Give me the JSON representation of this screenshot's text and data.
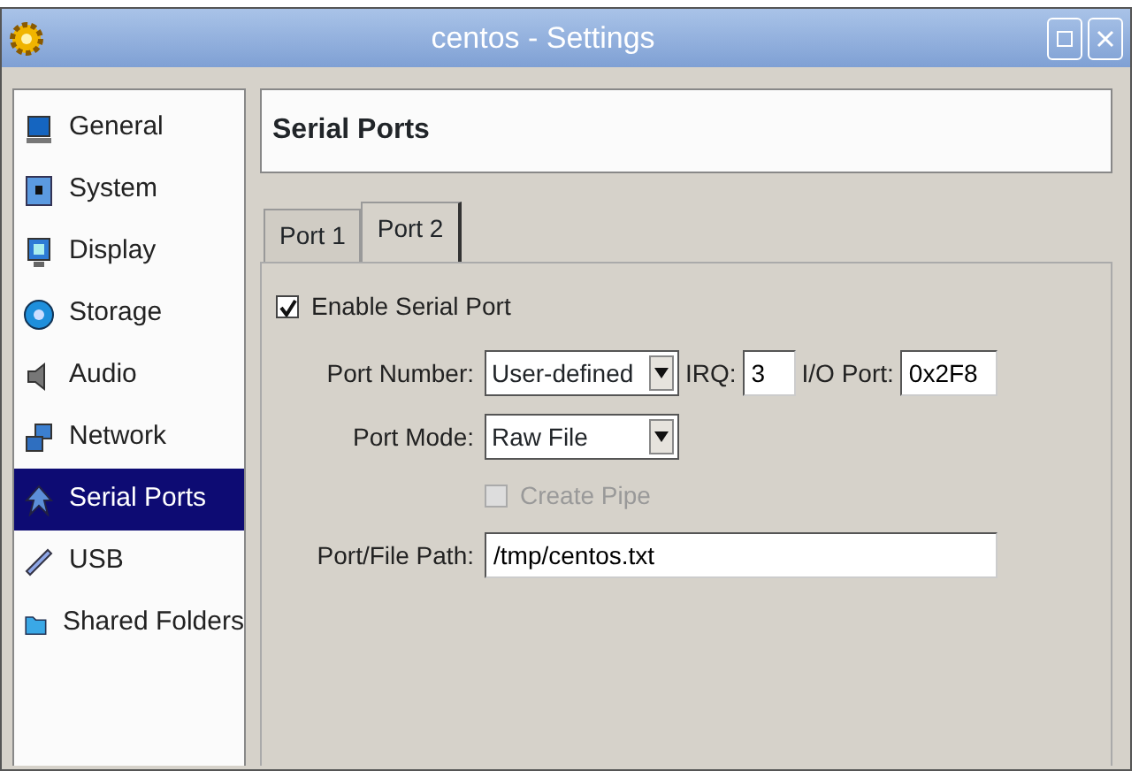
{
  "window": {
    "title": "centos - Settings"
  },
  "sidebar": {
    "items": [
      {
        "label": "General",
        "selected": false
      },
      {
        "label": "System",
        "selected": false
      },
      {
        "label": "Display",
        "selected": false
      },
      {
        "label": "Storage",
        "selected": false
      },
      {
        "label": "Audio",
        "selected": false
      },
      {
        "label": "Network",
        "selected": false
      },
      {
        "label": "Serial Ports",
        "selected": true
      },
      {
        "label": "USB",
        "selected": false
      },
      {
        "label": "Shared Folders",
        "selected": false
      }
    ]
  },
  "page": {
    "title": "Serial Ports"
  },
  "tabs": [
    {
      "label": "Port 1",
      "selected": false
    },
    {
      "label": "Port 2",
      "selected": true
    }
  ],
  "enable": {
    "label": "Enable Serial Port",
    "checked": true
  },
  "port_number": {
    "label": "Port Number:",
    "value": "User-defined"
  },
  "irq": {
    "label": "IRQ:",
    "value": "3"
  },
  "io_port": {
    "label": "I/O Port:",
    "value": "0x2F8"
  },
  "port_mode": {
    "label": "Port Mode:",
    "value": "Raw File"
  },
  "create_pipe": {
    "label": "Create Pipe",
    "checked": false,
    "disabled": true
  },
  "path": {
    "label": "Port/File Path:",
    "value": "/tmp/centos.txt"
  }
}
